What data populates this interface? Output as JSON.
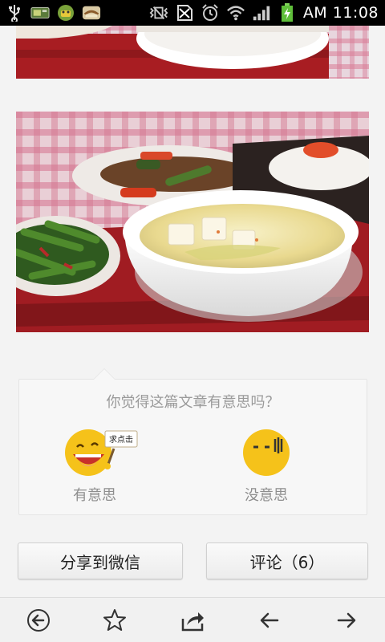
{
  "status_bar": {
    "time": "AM 11:08",
    "icons": [
      "usb-icon",
      "sim-card-icon",
      "android-app-icon",
      "app-notification-icon",
      "vibrate-icon",
      "no-sim-icon",
      "alarm-clock-icon",
      "wifi-icon",
      "signal-icon",
      "battery-charging-icon"
    ]
  },
  "article": {
    "images": [
      "food-photo-top",
      "food-photo-tofu-soup"
    ]
  },
  "feedback": {
    "question": "你觉得这篇文章有意思吗？",
    "like": {
      "label": "有意思",
      "sign_text": "求点击",
      "icon": "happy-face-icon"
    },
    "dislike": {
      "label": "没意思",
      "icon": "bored-face-icon"
    }
  },
  "actions": {
    "share_label": "分享到微信",
    "comment_label": "评论（6）"
  },
  "toolbar": {
    "icons": [
      "back-circle-icon",
      "star-icon",
      "share-icon",
      "arrow-left-icon",
      "arrow-right-icon"
    ]
  },
  "colors": {
    "accent_yellow": "#f5c21a",
    "background": "#f3f3f3",
    "tablecloth_red": "#b4202a"
  }
}
